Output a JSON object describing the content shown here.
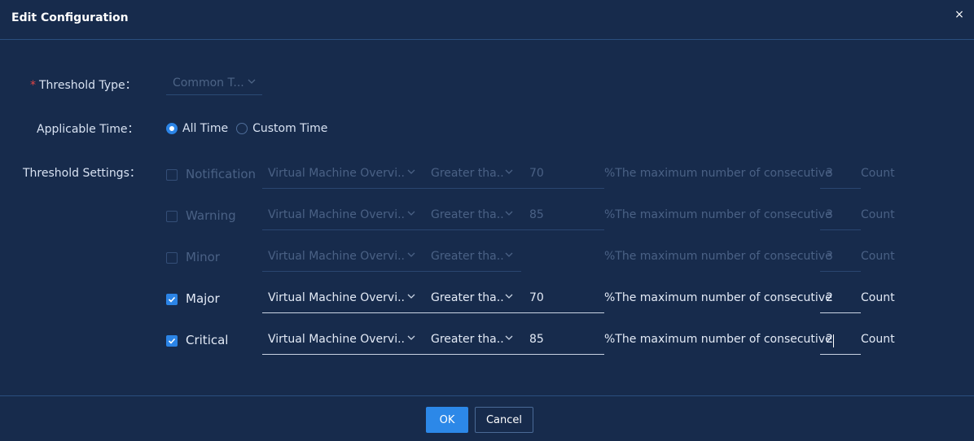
{
  "dialog": {
    "title": "Edit Configuration",
    "close_label": "×"
  },
  "form": {
    "threshold_type_label": "Threshold Type",
    "threshold_type_value": "Common T...",
    "applicable_time_label": "Applicable Time",
    "applicable_time_options": [
      "All Time",
      "Custom Time"
    ],
    "applicable_time_selected": "All Time",
    "threshold_settings_label": "Threshold Settings",
    "colon": "："
  },
  "thresholds": [
    {
      "level": "Notification",
      "checked": false,
      "metric": "Virtual Machine Overvi...",
      "operator": "Greater tha...",
      "value": "70",
      "description": "%The maximum number of consecutive",
      "count": "3",
      "unit": "Count"
    },
    {
      "level": "Warning",
      "checked": false,
      "metric": "Virtual Machine Overvi...",
      "operator": "Greater tha...",
      "value": "85",
      "description": "%The maximum number of consecutive",
      "count": "3",
      "unit": "Count"
    },
    {
      "level": "Minor",
      "checked": false,
      "metric": "Virtual Machine Overvi...",
      "operator": "Greater tha...",
      "value": "",
      "description": "%The maximum number of consecutive",
      "count": "3",
      "unit": "Count"
    },
    {
      "level": "Major",
      "checked": true,
      "metric": "Virtual Machine Overvi...",
      "operator": "Greater tha...",
      "value": "70",
      "description": "%The maximum number of consecutive",
      "count": "2",
      "unit": "Count"
    },
    {
      "level": "Critical",
      "checked": true,
      "metric": "Virtual Machine Overvi...",
      "operator": "Greater tha...",
      "value": "85",
      "description": "%The maximum number of consecutive",
      "count": "2",
      "unit": "Count"
    }
  ],
  "footer": {
    "ok_label": "OK",
    "cancel_label": "Cancel"
  },
  "colors": {
    "background": "#172b4c",
    "primary": "#2c88e8",
    "required": "#e04545"
  }
}
